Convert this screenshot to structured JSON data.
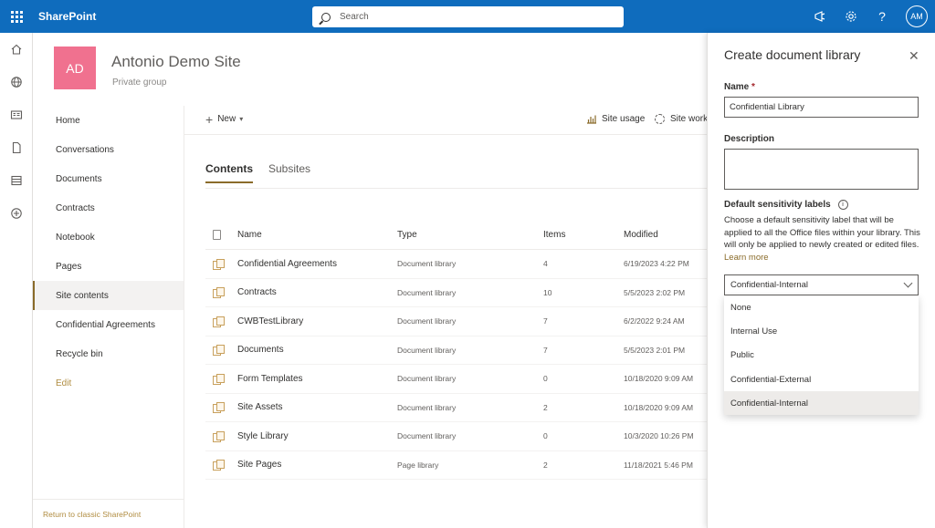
{
  "suitebar": {
    "brand": "SharePoint",
    "search_placeholder": "Search",
    "avatar_initials": "AM",
    "background": "#0f6cbd"
  },
  "site": {
    "logo_initials": "AD",
    "logo_color": "#f0718f",
    "title": "Antonio Demo Site",
    "subtitle": "Private group"
  },
  "leftnav": {
    "items": [
      {
        "label": "Home"
      },
      {
        "label": "Conversations"
      },
      {
        "label": "Documents"
      },
      {
        "label": "Contracts"
      },
      {
        "label": "Notebook"
      },
      {
        "label": "Pages"
      },
      {
        "label": "Site contents",
        "active": true
      },
      {
        "label": "Confidential Agreements"
      },
      {
        "label": "Recycle bin"
      }
    ],
    "edit_label": "Edit",
    "footer": "Return to classic SharePoint"
  },
  "commandbar": {
    "new_label": "New",
    "usage_label": "Site usage",
    "workflows_label": "Site work"
  },
  "tabs": [
    {
      "label": "Contents",
      "active": true
    },
    {
      "label": "Subsites"
    }
  ],
  "table": {
    "headers": {
      "name": "Name",
      "type": "Type",
      "items": "Items",
      "modified": "Modified"
    },
    "rows": [
      {
        "name": "Confidential Agreements",
        "type": "Document library",
        "items": "4",
        "modified": "6/19/2023 4:22 PM"
      },
      {
        "name": "Contracts",
        "type": "Document library",
        "items": "10",
        "modified": "5/5/2023 2:02 PM"
      },
      {
        "name": "CWBTestLibrary",
        "type": "Document library",
        "items": "7",
        "modified": "6/2/2022 9:24 AM"
      },
      {
        "name": "Documents",
        "type": "Document library",
        "items": "7",
        "modified": "5/5/2023 2:01 PM"
      },
      {
        "name": "Form Templates",
        "type": "Document library",
        "items": "0",
        "modified": "10/18/2020 9:09 AM"
      },
      {
        "name": "Site Assets",
        "type": "Document library",
        "items": "2",
        "modified": "10/18/2020 9:09 AM"
      },
      {
        "name": "Style Library",
        "type": "Document library",
        "items": "0",
        "modified": "10/3/2020 10:26 PM"
      },
      {
        "name": "Site Pages",
        "type": "Page library",
        "items": "2",
        "modified": "11/18/2021 5:46 PM"
      }
    ]
  },
  "panel": {
    "title": "Create document library",
    "name_label": "Name",
    "required_mark": "*",
    "name_value": "Confidential Library",
    "description_label": "Description",
    "description_value": "",
    "sensitivity_label": "Default sensitivity labels",
    "sensitivity_desc": "Choose a default sensitivity label that will be applied to all the Office files within your library. This will only be applied to newly created or edited files.",
    "learn_more": "Learn more",
    "selected_option": "Confidential-Internal",
    "options": [
      {
        "label": "None"
      },
      {
        "label": "Internal Use"
      },
      {
        "label": "Public"
      },
      {
        "label": "Confidential-External"
      },
      {
        "label": "Confidential-Internal",
        "selected": true
      }
    ]
  }
}
